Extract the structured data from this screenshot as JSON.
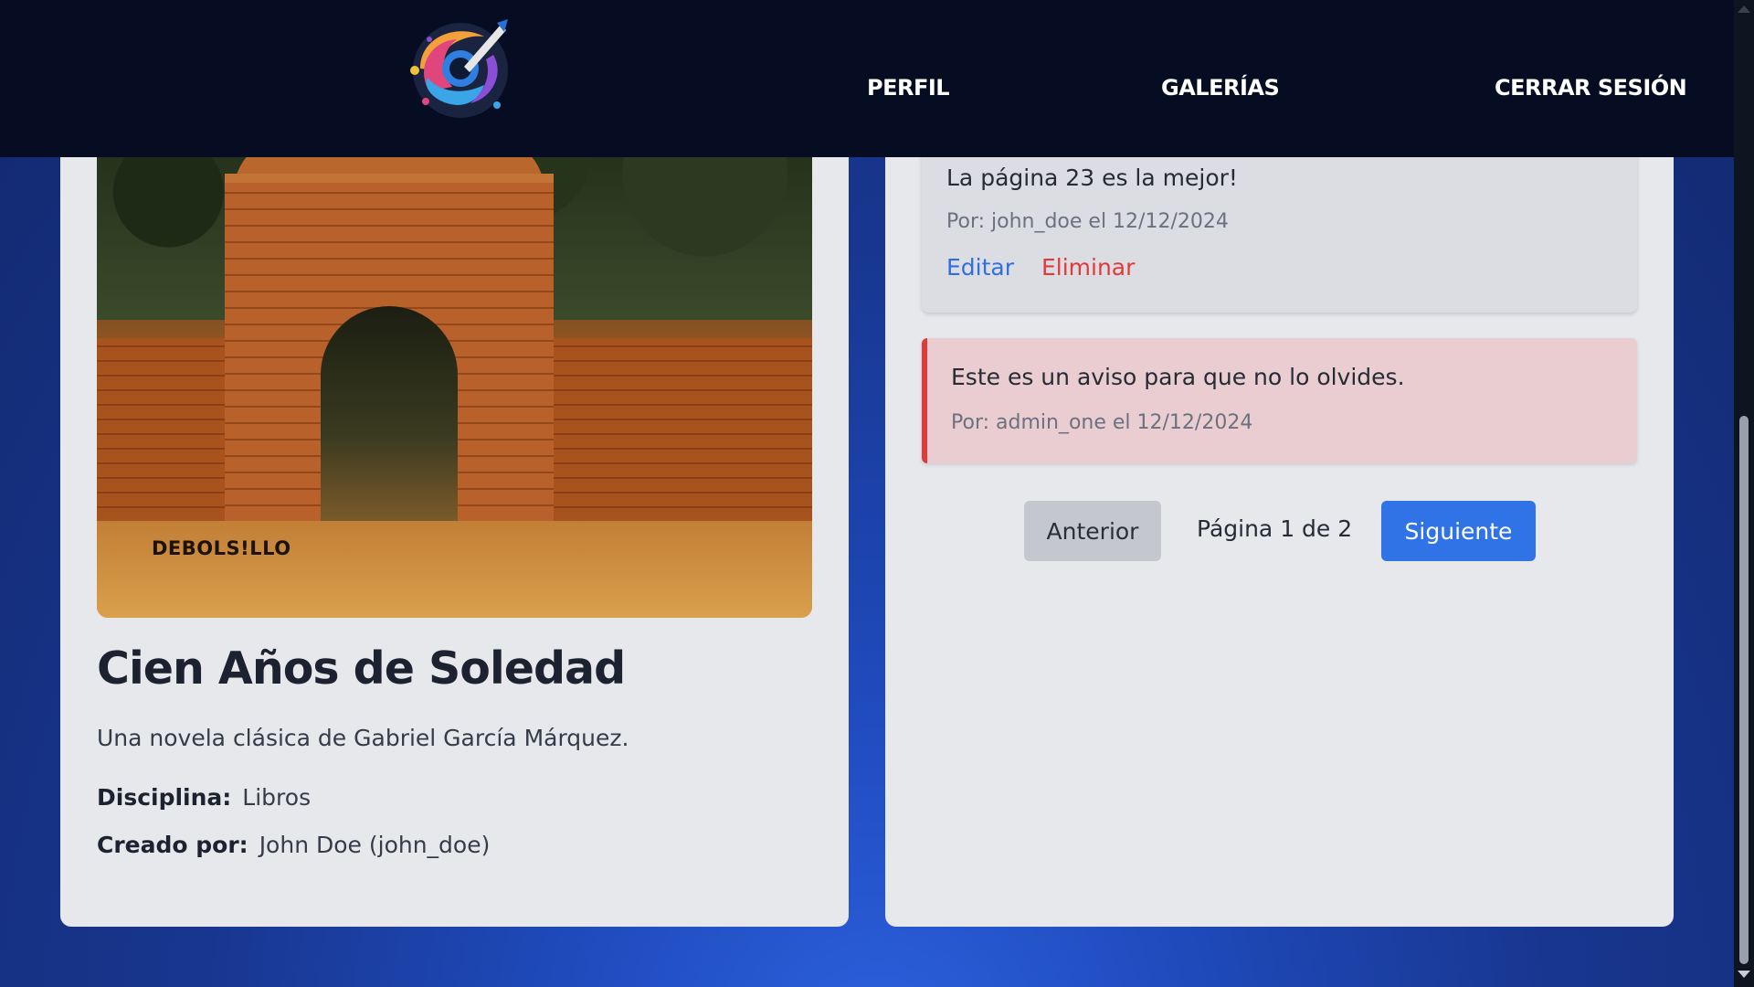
{
  "nav": {
    "items": [
      {
        "label": "PERFIL"
      },
      {
        "label": "GALERÍAS"
      },
      {
        "label": "CERRAR SESIÓN"
      }
    ]
  },
  "artwork": {
    "cover_publisher_text": "DEBOLS!LLO",
    "title": "Cien Años de Soledad",
    "description": "Una novela clásica de Gabriel García Márquez.",
    "discipline_label": "Disciplina:",
    "discipline_value": "Libros",
    "creator_label": "Creado por:",
    "creator_value": "John Doe (john_doe)"
  },
  "comments": [
    {
      "text": "La página 23 es la mejor!",
      "byline": "Por: john_doe el 12/12/2024",
      "edit_label": "Editar",
      "delete_label": "Eliminar"
    }
  ],
  "notice": {
    "text": "Este es un aviso para que no lo olvides.",
    "byline": "Por: admin_one el 12/12/2024",
    "accent_color": "#e03a3a"
  },
  "pagination": {
    "prev_label": "Anterior",
    "info": "Página 1 de 2",
    "next_label": "Siguiente"
  },
  "colors": {
    "header_bg": "#060c22",
    "card_bg": "#e7e8ec",
    "primary": "#2f73e6",
    "danger": "#e03a3a"
  },
  "icons": {
    "logo": "paint-palette-swirl-logo"
  }
}
